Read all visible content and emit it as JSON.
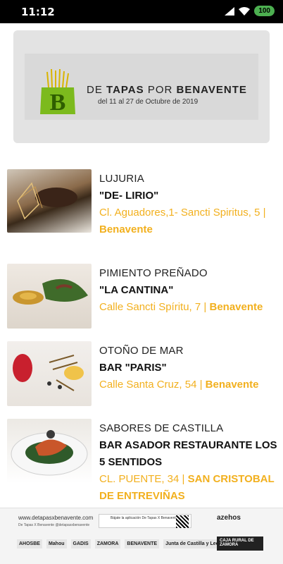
{
  "status": {
    "time": "11:12",
    "battery": "100"
  },
  "banner": {
    "title_prefix": "DE",
    "title_main": "TAPAS",
    "title_mid": "POR",
    "title_city": "BENAVENTE",
    "subtitle": "del 11 al 27 de Octubre de 2019"
  },
  "items": [
    {
      "dish": "LUJURIA",
      "bar": "\"DE- LIRIO\"",
      "address": "Cl. Aguadores,1- Sancti Spiritus, 5 |",
      "city": "Benavente"
    },
    {
      "dish": "PIMIENTO PREÑADO",
      "bar": "\"LA CANTINA\"",
      "address": "Calle Sancti Spíritu, 7 |",
      "city": "Benavente"
    },
    {
      "dish": "OTOÑO DE MAR",
      "bar": "BAR \"PARIS\"",
      "address": "Calle Santa Cruz, 54 |",
      "city": "Benavente"
    },
    {
      "dish": "SABORES DE CASTILLA",
      "bar": "BAR ASADOR RESTAURANTE LOS 5 SENTIDOS",
      "address": "CL. PUENTE, 34 |",
      "city": "SAN CRISTOBAL DE ENTREVIÑAS"
    }
  ],
  "footer": {
    "url": "www.detapasxbenavente.com",
    "social": "De Tapas X Benavente   @detapasxbenavente",
    "app": "Bájate la aplicación De Tapas X Benavente",
    "azehos": "azehos",
    "sponsors": [
      "AHOSBE",
      "Mahou",
      "GADIS",
      "ZAMORA",
      "BENAVENTE",
      "Junta de Castilla y León"
    ],
    "bank": "CAJA RURAL DE ZAMORA"
  }
}
